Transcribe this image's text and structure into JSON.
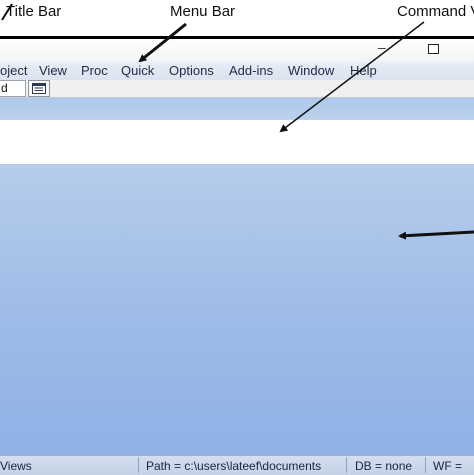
{
  "annotations": {
    "title_bar": "Title Bar",
    "menu_bar": "Menu Bar",
    "command_window": "Command V"
  },
  "menu": {
    "items": [
      "oject",
      "View",
      "Proc",
      "Quick",
      "Options",
      "Add-ins",
      "Window",
      "Help"
    ]
  },
  "toolbar": {
    "input_value": "d"
  },
  "window_controls": {
    "minimize": "–"
  },
  "statusbar": {
    "views": "Views",
    "path": "Path = c:\\users\\lateef\\documents",
    "db": "DB = none",
    "wf": "WF ="
  }
}
